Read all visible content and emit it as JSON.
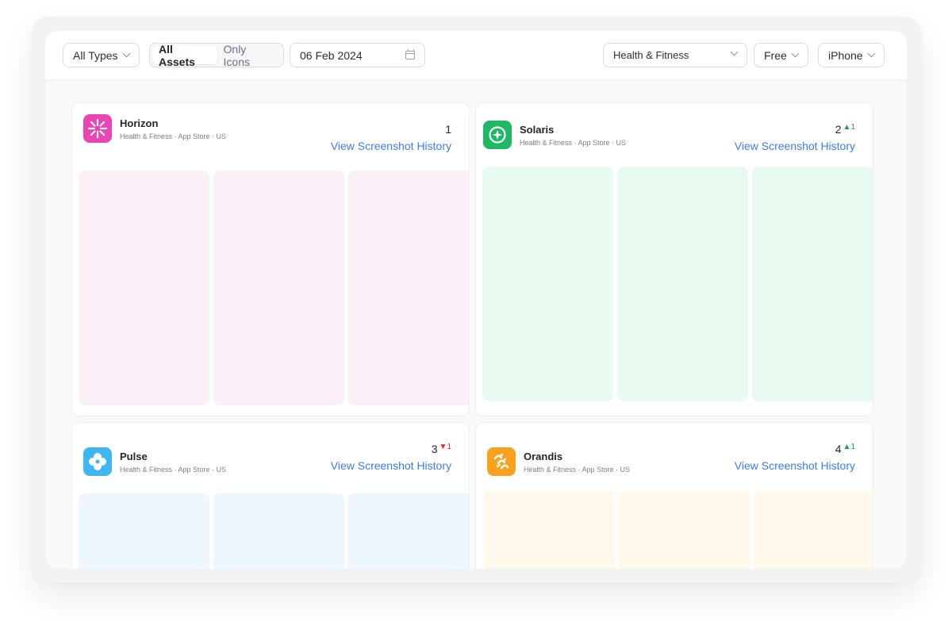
{
  "toolbar": {
    "type_filter": "All Types",
    "segment": [
      "All Assets",
      "Only Icons"
    ],
    "date": "06 Feb 2024",
    "category": "Health & Fitness",
    "price": "Free",
    "device": "iPhone"
  },
  "cards": [
    {
      "name": "Horizon",
      "meta": "Health & Fitness · App Store · US",
      "rank": "1",
      "change": "",
      "change_dir": "none",
      "link": "View Screenshot History",
      "icon": "flower-icon",
      "icon_color": "#e945b3",
      "shot_color": "#fcf0f8"
    },
    {
      "name": "Solaris",
      "meta": "Health & Fitness · App Store · US",
      "rank": "2",
      "change": "1",
      "change_dir": "up",
      "link": "View Screenshot History",
      "icon": "compass-icon",
      "icon_color": "#1fb865",
      "shot_color": "#e9fbf0"
    },
    {
      "name": "Pulse",
      "meta": "Health & Fitness · App Store · US",
      "rank": "3",
      "change": "1",
      "change_dir": "down",
      "link": "View Screenshot History",
      "icon": "clover-icon",
      "icon_color": "#3fb6f0",
      "shot_color": "#eef6fe"
    },
    {
      "name": "Orandis",
      "meta": "Health & Fitness · App Store · US",
      "rank": "4",
      "change": "1",
      "change_dir": "up",
      "link": "View Screenshot History",
      "icon": "dna-icon",
      "icon_color": "#f7a11f",
      "shot_color": "#fff8eb"
    }
  ]
}
